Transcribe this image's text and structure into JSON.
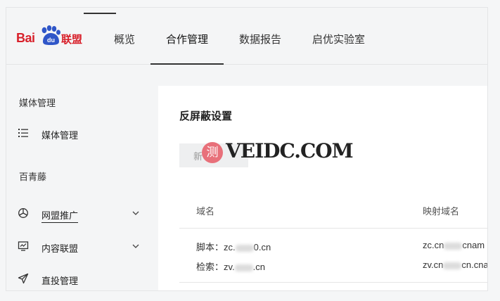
{
  "brand": {
    "logo_text_left": "Bai",
    "logo_paw_text": "du",
    "logo_text_right": "联盟"
  },
  "nav": {
    "items": [
      {
        "label": "概览"
      },
      {
        "label": "合作管理"
      },
      {
        "label": "数据报告"
      },
      {
        "label": "启优实验室"
      }
    ],
    "active_index": 1
  },
  "sidebar": {
    "group1_title": "媒体管理",
    "group1_items": [
      {
        "label": "媒体管理",
        "icon": "list-icon"
      }
    ],
    "group2_title": "百青藤",
    "group2_items": [
      {
        "label": "网盟推广",
        "icon": "pie-chart-icon",
        "expandable": true
      },
      {
        "label": "内容联盟",
        "icon": "monitor-icon",
        "expandable": true
      },
      {
        "label": "直投管理",
        "icon": "send-icon",
        "expandable": false
      }
    ]
  },
  "main": {
    "title": "反屏蔽设置",
    "add_button_label": "新",
    "watermark": {
      "badge": "测",
      "text": "VEIDC.COM"
    },
    "table": {
      "headers": [
        "域名",
        "映射域名"
      ],
      "rows": [
        {
          "domain_lines": [
            {
              "prefix": "脚本：",
              "value_start": "zc.",
              "value_end": "0.cn"
            },
            {
              "prefix": "检索：",
              "value_start": "zv.",
              "value_end": ".cn"
            }
          ],
          "mapped_lines": [
            {
              "value_start": "zc.cn",
              "value_end": "cnam"
            },
            {
              "value_start": "zv.cn",
              "value_end": "cn.cnam"
            }
          ]
        }
      ]
    }
  },
  "colors": {
    "brand_red": "#d8202a",
    "watermark_badge": "#e8707a"
  }
}
